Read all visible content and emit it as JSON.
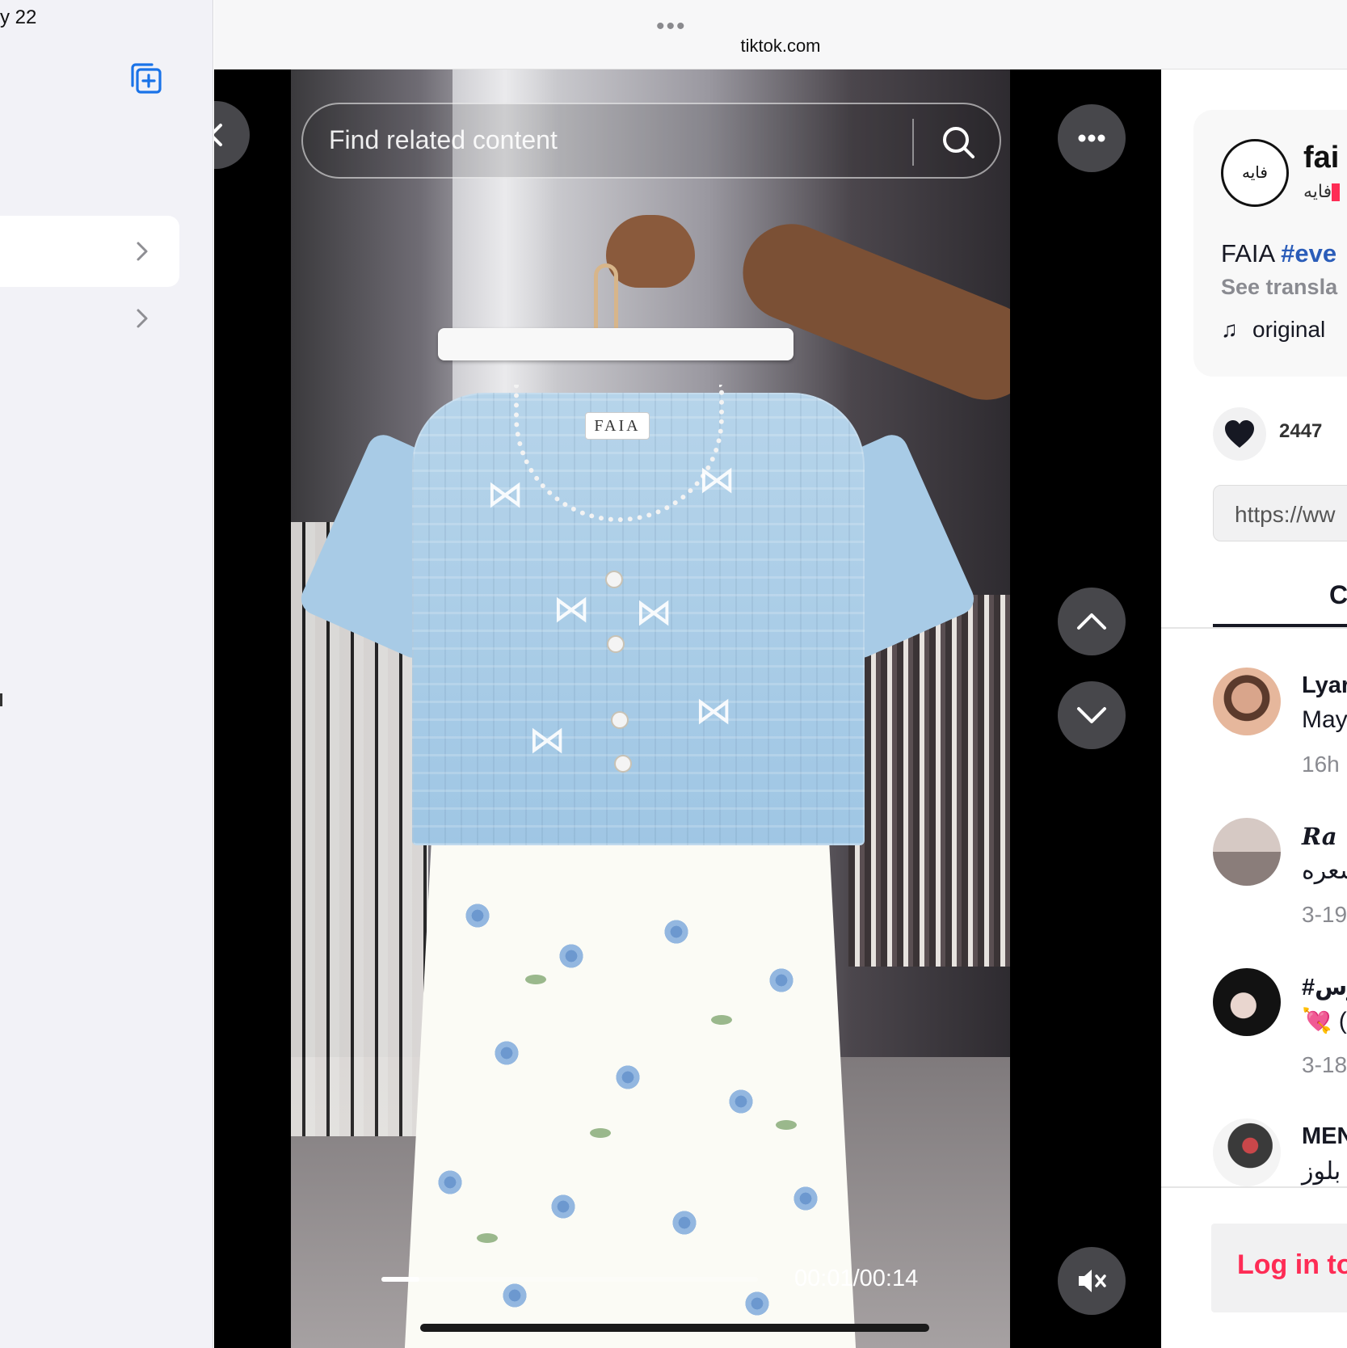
{
  "sidebar": {
    "date_fragment": "y 22",
    "new_tab_group_icon": "plus-square-on-square-icon",
    "rows": [
      {
        "selected": true,
        "chevron_icon": "chevron-right-icon"
      },
      {
        "selected": false,
        "chevron_icon": "chevron-right-icon"
      }
    ]
  },
  "browser": {
    "menu_dots": "•••",
    "url": "tiktok.com"
  },
  "player": {
    "search_placeholder": "Find related content",
    "search_icon": "search-icon",
    "close_icon": "close-chevron-icon",
    "more_icon": "more-horizontal-icon",
    "prev_icon": "chevron-up-icon",
    "next_icon": "chevron-down-icon",
    "mute_icon": "speaker-muted-icon",
    "timecode": "00:01/00:14",
    "progress": 0.1,
    "product_tag": "FAIA"
  },
  "panel": {
    "author": {
      "username": "fai",
      "avatar_text": "فايه",
      "nickname": "فايه"
    },
    "caption": {
      "brand": "FAIA",
      "hashtag": "#eve",
      "see_translation": "See transla"
    },
    "music": {
      "note_icon": "music-note-icon",
      "title": "original"
    },
    "likes": {
      "icon": "heart-icon",
      "count": "2447"
    },
    "link": "https://ww",
    "tab_label": "C",
    "comments": [
      {
        "name": "Lyar",
        "text": "May",
        "time": "16h"
      },
      {
        "name": "Ra",
        "text": "سعره",
        "time": "3-19"
      },
      {
        "name": "#رس",
        "text": "💘 (",
        "time": "3-18"
      },
      {
        "name": "MEN",
        "text": "بلوز",
        "time": ""
      }
    ],
    "login_label": "Log in to"
  },
  "colors": {
    "accent_blue": "#1a73e8",
    "tiktok_pink": "#fe2c55",
    "hashtag_blue": "#2b5db9",
    "muted_text": "#8a8b91"
  }
}
